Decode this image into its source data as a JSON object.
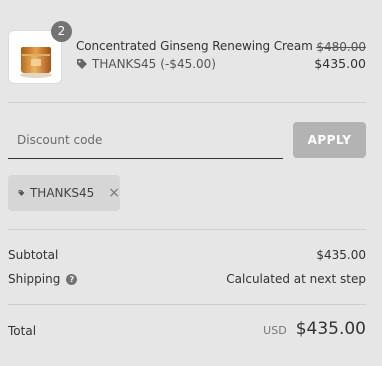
{
  "cart": {
    "item": {
      "quantity": "2",
      "name": "Concentrated Ginseng Renewing Cream",
      "discount_code": "THANKS45",
      "discount_amount": "(-$45.00)",
      "original_price": "$480.00",
      "price": "$435.00",
      "image_icon": "cream-jar-icon"
    }
  },
  "discount": {
    "placeholder": "Discount code",
    "apply_label": "APPLY"
  },
  "applied_tag": {
    "code": "THANKS45",
    "icon": "tag-icon",
    "remove_glyph": "×"
  },
  "summary": {
    "subtotal_label": "Subtotal",
    "subtotal_value": "$435.00",
    "shipping_label": "Shipping",
    "shipping_value": "Calculated at next step",
    "help_glyph": "?",
    "total_label": "Total",
    "currency": "USD",
    "total_value": "$435.00"
  },
  "colors": {
    "background": "#e6e6e6",
    "button": "#b3b3b3",
    "chip": "#d6d6d6",
    "badge": "#737373",
    "product_gold": "#c8832b"
  }
}
